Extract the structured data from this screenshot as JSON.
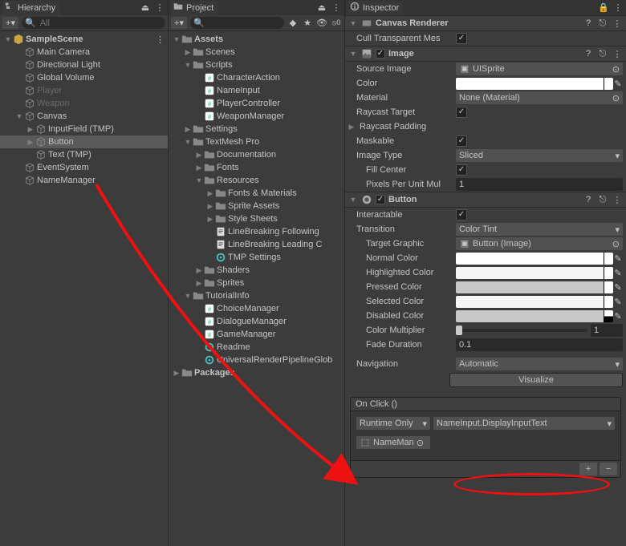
{
  "hierarchy": {
    "tab": "Hierarchy",
    "searchPlaceholder": "All",
    "tree": [
      {
        "d": 0,
        "t": "▼",
        "icon": "unity",
        "label": "SampleScene",
        "bold": true,
        "menu": true
      },
      {
        "d": 1,
        "t": "",
        "icon": "cube",
        "label": "Main Camera"
      },
      {
        "d": 1,
        "t": "",
        "icon": "cube",
        "label": "Directional Light"
      },
      {
        "d": 1,
        "t": "",
        "icon": "cube",
        "label": "Global Volume"
      },
      {
        "d": 1,
        "t": "",
        "icon": "cube",
        "label": "Player",
        "fade": true
      },
      {
        "d": 1,
        "t": "",
        "icon": "cube",
        "label": "Weapon",
        "fade": true
      },
      {
        "d": 1,
        "t": "▼",
        "icon": "cube",
        "label": "Canvas"
      },
      {
        "d": 2,
        "t": "▶",
        "icon": "cube",
        "label": "InputField (TMP)"
      },
      {
        "d": 2,
        "t": "▶",
        "icon": "cube",
        "label": "Button",
        "sel": true
      },
      {
        "d": 2,
        "t": "",
        "icon": "cube",
        "label": "Text (TMP)"
      },
      {
        "d": 1,
        "t": "",
        "icon": "cube",
        "label": "EventSystem"
      },
      {
        "d": 1,
        "t": "",
        "icon": "cube",
        "label": "NameManager"
      }
    ]
  },
  "project": {
    "tab": "Project",
    "tree": [
      {
        "d": 0,
        "t": "▼",
        "icon": "folder",
        "label": "Assets",
        "bold": true
      },
      {
        "d": 1,
        "t": "▶",
        "icon": "folder",
        "label": "Scenes"
      },
      {
        "d": 1,
        "t": "▼",
        "icon": "folder",
        "label": "Scripts"
      },
      {
        "d": 2,
        "t": "",
        "icon": "cs",
        "label": "CharacterAction"
      },
      {
        "d": 2,
        "t": "",
        "icon": "cs",
        "label": "NameInput"
      },
      {
        "d": 2,
        "t": "",
        "icon": "cs",
        "label": "PlayerController"
      },
      {
        "d": 2,
        "t": "",
        "icon": "cs",
        "label": "WeaponManager"
      },
      {
        "d": 1,
        "t": "▶",
        "icon": "folder",
        "label": "Settings"
      },
      {
        "d": 1,
        "t": "▼",
        "icon": "folder",
        "label": "TextMesh Pro"
      },
      {
        "d": 2,
        "t": "▶",
        "icon": "folder",
        "label": "Documentation"
      },
      {
        "d": 2,
        "t": "▶",
        "icon": "folder",
        "label": "Fonts"
      },
      {
        "d": 2,
        "t": "▼",
        "icon": "folder",
        "label": "Resources"
      },
      {
        "d": 3,
        "t": "▶",
        "icon": "folder",
        "label": "Fonts & Materials"
      },
      {
        "d": 3,
        "t": "▶",
        "icon": "folder",
        "label": "Sprite Assets"
      },
      {
        "d": 3,
        "t": "▶",
        "icon": "folder",
        "label": "Style Sheets"
      },
      {
        "d": 3,
        "t": "",
        "icon": "txt",
        "label": "LineBreaking Following"
      },
      {
        "d": 3,
        "t": "",
        "icon": "txt",
        "label": "LineBreaking Leading C"
      },
      {
        "d": 3,
        "t": "",
        "icon": "asset",
        "label": "TMP Settings"
      },
      {
        "d": 2,
        "t": "▶",
        "icon": "folder",
        "label": "Shaders"
      },
      {
        "d": 2,
        "t": "▶",
        "icon": "folder",
        "label": "Sprites"
      },
      {
        "d": 1,
        "t": "▼",
        "icon": "folder",
        "label": "TutorialInfo"
      },
      {
        "d": 2,
        "t": "",
        "icon": "cs",
        "label": "ChoiceManager"
      },
      {
        "d": 2,
        "t": "",
        "icon": "cs",
        "label": "DialogueManager"
      },
      {
        "d": 2,
        "t": "",
        "icon": "cs",
        "label": "GameManager"
      },
      {
        "d": 2,
        "t": "",
        "icon": "asset",
        "label": "Readme"
      },
      {
        "d": 2,
        "t": "",
        "icon": "asset",
        "label": "UniversalRenderPipelineGlob"
      },
      {
        "d": 0,
        "t": "▶",
        "icon": "folder",
        "label": "Packages",
        "bold": true
      }
    ]
  },
  "inspector": {
    "tab": "Inspector",
    "components": [
      {
        "name": "Canvas Renderer",
        "props": [
          {
            "label": "Cull Transparent Mes",
            "value": true
          }
        ]
      },
      {
        "name": "Image",
        "props": [
          {
            "label": "Source Image",
            "value": "UISprite"
          },
          {
            "label": "Color",
            "value": "#FFFFFF"
          },
          {
            "label": "Material",
            "value": "None (Material)"
          },
          {
            "label": "Raycast Target",
            "value": true
          },
          {
            "label": "Raycast Padding"
          },
          {
            "label": "Maskable",
            "value": true
          },
          {
            "label": "Image Type",
            "value": "Sliced"
          },
          {
            "label": "Fill Center",
            "value": true
          },
          {
            "label": "Pixels Per Unit Mul",
            "value": "1"
          }
        ]
      },
      {
        "name": "Button",
        "props": [
          {
            "label": "Interactable",
            "value": true
          },
          {
            "label": "Transition",
            "value": "Color Tint"
          },
          {
            "label": "Target Graphic",
            "value": "Button (Image)"
          },
          {
            "label": "Normal Color",
            "value": "#FFFFFF"
          },
          {
            "label": "Highlighted Color",
            "value": "#F5F5F5"
          },
          {
            "label": "Pressed Color",
            "value": "#C8C8C8"
          },
          {
            "label": "Selected Color",
            "value": "#F5F5F5"
          },
          {
            "label": "Disabled Color",
            "value": "#C8C8C880"
          },
          {
            "label": "Color Multiplier",
            "value": "1"
          },
          {
            "label": "Fade Duration",
            "value": "0.1"
          },
          {
            "label": "Navigation",
            "value": "Automatic"
          }
        ],
        "visualize": "Visualize",
        "onclick": {
          "header": "On Click ()",
          "runtime": "Runtime Only",
          "function": "NameInput.DisplayInputText",
          "target": "NameMan"
        }
      }
    ]
  },
  "icons": {
    "unity": "#c9a642",
    "cube": "#888",
    "folder": "#888",
    "cs": "#62c58d",
    "txt": "#ddd",
    "asset": "#4dc4c4"
  }
}
